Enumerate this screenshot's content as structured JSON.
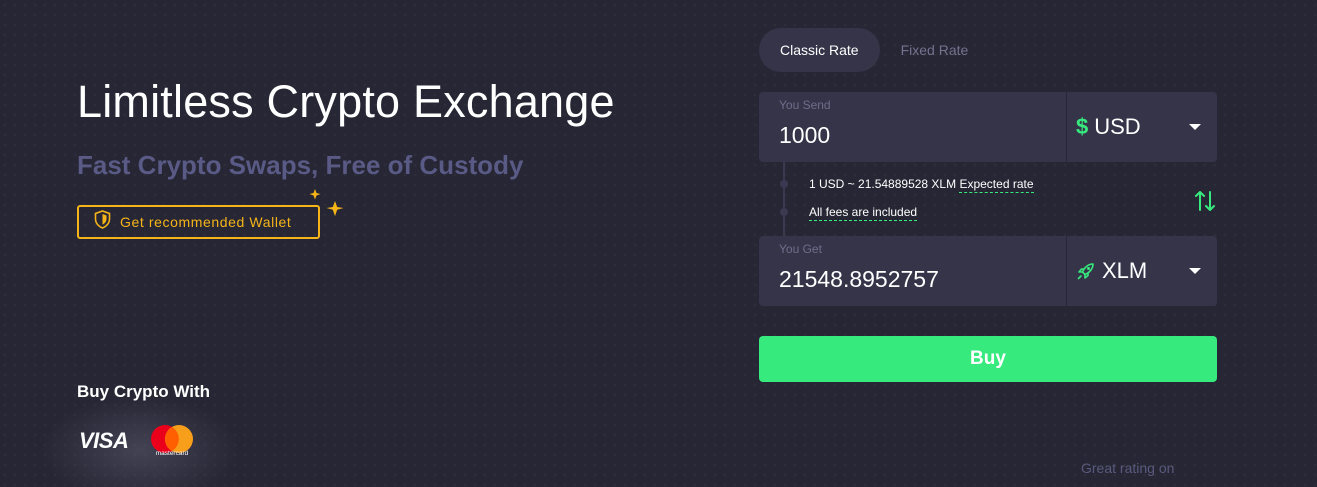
{
  "hero": {
    "title": "Limitless Crypto Exchange",
    "subtitle": "Fast Crypto Swaps, Free of Custody",
    "wallet_button": "Get recommended Wallet"
  },
  "payments": {
    "heading": "Buy Crypto With",
    "visa": "VISA",
    "mastercard": "mastercard"
  },
  "exchange": {
    "tabs": [
      {
        "label": "Classic Rate",
        "active": true
      },
      {
        "label": "Fixed Rate",
        "active": false
      }
    ],
    "send": {
      "label": "You Send",
      "value": "1000",
      "currency": "USD",
      "currency_icon": "dollar-icon"
    },
    "rate": {
      "text": "1 USD ~ 21.54889528 XLM",
      "link": "Expected rate"
    },
    "fees": "All fees are included",
    "get": {
      "label": "You Get",
      "value": "21548.8952757",
      "currency": "XLM",
      "currency_icon": "rocket-icon"
    },
    "buy_button": "Buy"
  },
  "footer": {
    "rating": "Great rating on"
  },
  "colors": {
    "background": "#262634",
    "panel": "#353449",
    "accent_green": "#37ea7e",
    "accent_gold": "#f5b418",
    "muted": "#5a5a86"
  }
}
